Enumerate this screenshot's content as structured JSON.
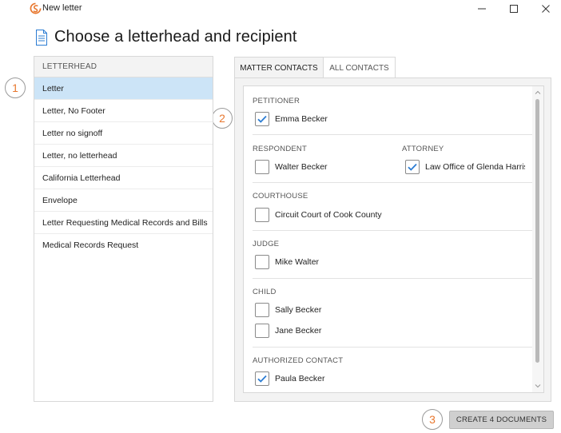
{
  "window": {
    "title": "New letter",
    "minimize_glyph": "—",
    "icon": "app-logo-icon"
  },
  "page": {
    "title": "Choose a letterhead and recipient",
    "icon": "document-icon"
  },
  "steps": [
    "1",
    "2",
    "3"
  ],
  "letterhead": {
    "header": "LETTERHEAD",
    "items": [
      {
        "label": "Letter",
        "selected": true
      },
      {
        "label": "Letter, No Footer",
        "selected": false
      },
      {
        "label": "Letter no signoff",
        "selected": false
      },
      {
        "label": "Letter, no letterhead",
        "selected": false
      },
      {
        "label": "California Letterhead",
        "selected": false
      },
      {
        "label": "Envelope",
        "selected": false
      },
      {
        "label": "Letter Requesting Medical Records and Bills",
        "selected": false
      },
      {
        "label": "Medical Records Request",
        "selected": false
      }
    ]
  },
  "tabs": [
    {
      "label": "MATTER CONTACTS",
      "active": true
    },
    {
      "label": "ALL CONTACTS",
      "active": false
    }
  ],
  "contacts": {
    "petitioner": {
      "label": "PETITIONER",
      "items": [
        {
          "name": "Emma Becker",
          "checked": true
        }
      ]
    },
    "respondent": {
      "label": "RESPONDENT",
      "items": [
        {
          "name": "Walter Becker",
          "checked": false
        }
      ]
    },
    "attorney": {
      "label": "ATTORNEY",
      "items": [
        {
          "name": "Law Office of Glenda Harriso",
          "checked": true
        }
      ]
    },
    "courthouse": {
      "label": "COURTHOUSE",
      "items": [
        {
          "name": "Circuit Court of Cook County",
          "checked": false
        }
      ]
    },
    "judge": {
      "label": "JUDGE",
      "items": [
        {
          "name": "Mike Walter",
          "checked": false
        }
      ]
    },
    "child": {
      "label": "CHILD",
      "items": [
        {
          "name": "Sally Becker",
          "checked": false
        },
        {
          "name": "Jane Becker",
          "checked": false
        }
      ]
    },
    "authorized_contact": {
      "label": "AUTHORIZED CONTACT",
      "items": [
        {
          "name": "Paula Becker",
          "checked": true
        }
      ]
    }
  },
  "actions": {
    "create_label": "CREATE 4 DOCUMENTS"
  },
  "colors": {
    "accent": "#e8772e",
    "selection": "#cce4f7",
    "check": "#2b7cd3"
  }
}
